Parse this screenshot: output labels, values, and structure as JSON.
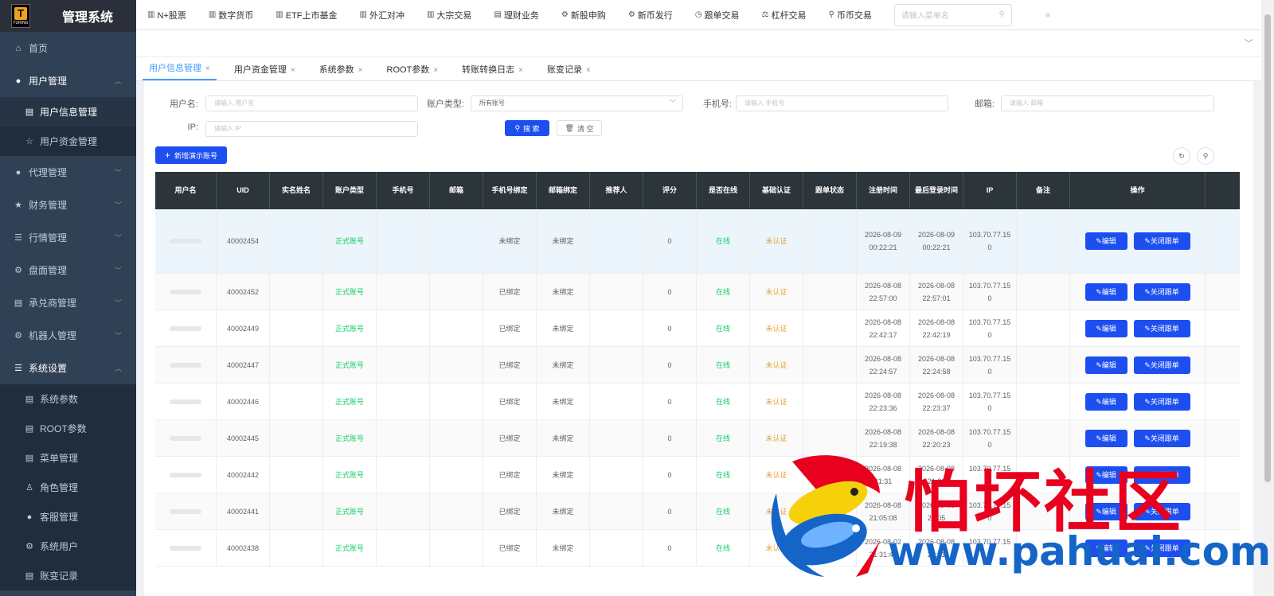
{
  "app": {
    "logo_text": "T",
    "logo_sub": "TURING",
    "title": "管理系统"
  },
  "sidebar": {
    "items": [
      {
        "label": "首页",
        "icon": "home-icon",
        "glyph": "⌂"
      },
      {
        "label": "用户管理",
        "icon": "user-icon",
        "glyph": "●",
        "expanded": true,
        "children": [
          {
            "label": "用户信息管理",
            "icon": "id-card-icon",
            "glyph": "▤",
            "active": true
          },
          {
            "label": "用户资金管理",
            "icon": "star-icon",
            "glyph": "☆"
          }
        ]
      },
      {
        "label": "代理管理",
        "icon": "user-icon",
        "glyph": "●"
      },
      {
        "label": "财务管理",
        "icon": "star-icon",
        "glyph": "★"
      },
      {
        "label": "行情管理",
        "icon": "list-icon",
        "glyph": "☰"
      },
      {
        "label": "盘面管理",
        "icon": "gear-icon",
        "glyph": "⚙"
      },
      {
        "label": "承兑商管理",
        "icon": "document-icon",
        "glyph": "▤"
      },
      {
        "label": "机器人管理",
        "icon": "gear-icon",
        "glyph": "⚙"
      },
      {
        "label": "系统设置",
        "icon": "list-icon",
        "glyph": "☰",
        "expanded": true,
        "children": [
          {
            "label": "系统参数",
            "icon": "document-icon",
            "glyph": "▤"
          },
          {
            "label": "ROOT参数",
            "icon": "document-icon",
            "glyph": "▤"
          },
          {
            "label": "菜单管理",
            "icon": "document-icon",
            "glyph": "▤"
          },
          {
            "label": "角色管理",
            "icon": "role-icon",
            "glyph": "♙"
          },
          {
            "label": "客服管理",
            "icon": "user-icon",
            "glyph": "●"
          },
          {
            "label": "系统用户",
            "icon": "gear-icon",
            "glyph": "⚙"
          },
          {
            "label": "账变记录",
            "icon": "document-icon",
            "glyph": "▤"
          }
        ]
      }
    ]
  },
  "topnav": {
    "items": [
      {
        "label": "N+股票",
        "icon": "chart-icon",
        "glyph": "▥"
      },
      {
        "label": "数字货币",
        "icon": "chart-icon",
        "glyph": "▥"
      },
      {
        "label": "ETF上市基金",
        "icon": "chart-icon",
        "glyph": "▥"
      },
      {
        "label": "外汇对冲",
        "icon": "chart-icon",
        "glyph": "▥"
      },
      {
        "label": "大宗交易",
        "icon": "chart-icon",
        "glyph": "▥"
      },
      {
        "label": "理财业务",
        "icon": "document-icon",
        "glyph": "▤"
      },
      {
        "label": "新股申购",
        "icon": "gear-icon",
        "glyph": "⚙"
      },
      {
        "label": "新币发行",
        "icon": "gear-icon",
        "glyph": "⚙"
      },
      {
        "label": "跟单交易",
        "icon": "clock-icon",
        "glyph": "◷"
      },
      {
        "label": "杠杆交易",
        "icon": "lever-icon",
        "glyph": "⚖"
      },
      {
        "label": "币币交易",
        "icon": "pin-icon",
        "glyph": "⚲"
      }
    ],
    "search_placeholder": "请输入菜单名"
  },
  "tabs": [
    {
      "label": "用户信息管理",
      "active": true
    },
    {
      "label": "用户资金管理"
    },
    {
      "label": "系统参数"
    },
    {
      "label": "ROOT参数"
    },
    {
      "label": "转账转换日志"
    },
    {
      "label": "账变记录"
    }
  ],
  "filters": {
    "username_label": "用户名:",
    "username_placeholder": "请输入 用户名",
    "type_label": "账户类型:",
    "type_value": "所有账号",
    "phone_label": "手机号:",
    "phone_placeholder": "请输入 手机号",
    "email_label": "邮箱:",
    "email_placeholder": "请输入 邮箱",
    "ip_label": "IP:",
    "ip_placeholder": "请输入 IP",
    "search_button": "搜 索",
    "clear_button": "清 空",
    "add_button": "新增演示账号"
  },
  "table": {
    "columns": [
      "用户名",
      "UID",
      "实名姓名",
      "账户类型",
      "手机号",
      "邮箱",
      "手机号绑定",
      "邮箱绑定",
      "推荐人",
      "评分",
      "是否在线",
      "基础认证",
      "跟单状态",
      "注册时间",
      "最后登录时间",
      "IP",
      "备注",
      "操作"
    ],
    "edit_label": "编辑",
    "close_label": "关闭跟单",
    "rows": [
      {
        "uid": "40002454",
        "type": "正式账号",
        "phone_bind": "未绑定",
        "email_bind": "未绑定",
        "score": "0",
        "online": "在线",
        "auth": "未认证",
        "reg_date": "2026-08-09",
        "reg_time": "00:22:21",
        "login_date": "2026-08-09",
        "login_time": "00:22:21",
        "ip1": "103.70.77.15",
        "ip2": "0"
      },
      {
        "uid": "40002452",
        "type": "正式账号",
        "phone_bind": "已绑定",
        "email_bind": "未绑定",
        "score": "0",
        "online": "在线",
        "auth": "未认证",
        "reg_date": "2026-08-08",
        "reg_time": "22:57:00",
        "login_date": "2026-08-08",
        "login_time": "22:57:01",
        "ip1": "103.70.77.15",
        "ip2": "0"
      },
      {
        "uid": "40002449",
        "type": "正式账号",
        "phone_bind": "已绑定",
        "email_bind": "未绑定",
        "score": "0",
        "online": "在线",
        "auth": "未认证",
        "reg_date": "2026-08-08",
        "reg_time": "22:42:17",
        "login_date": "2026-08-08",
        "login_time": "22:42:19",
        "ip1": "103.70.77.15",
        "ip2": "0"
      },
      {
        "uid": "40002447",
        "type": "正式账号",
        "phone_bind": "已绑定",
        "email_bind": "未绑定",
        "score": "0",
        "online": "在线",
        "auth": "未认证",
        "reg_date": "2026-08-08",
        "reg_time": "22:24:57",
        "login_date": "2026-08-08",
        "login_time": "22:24:58",
        "ip1": "103.70.77.15",
        "ip2": "0"
      },
      {
        "uid": "40002446",
        "type": "正式账号",
        "phone_bind": "已绑定",
        "email_bind": "未绑定",
        "score": "0",
        "online": "在线",
        "auth": "未认证",
        "reg_date": "2026-08-08",
        "reg_time": "22:23:36",
        "login_date": "2026-08-08",
        "login_time": "22:23:37",
        "ip1": "103.70.77.15",
        "ip2": "0"
      },
      {
        "uid": "40002445",
        "type": "正式账号",
        "phone_bind": "已绑定",
        "email_bind": "未绑定",
        "score": "0",
        "online": "在线",
        "auth": "未认证",
        "reg_date": "2026-08-08",
        "reg_time": "22:19:38",
        "login_date": "2026-08-08",
        "login_time": "22:20:23",
        "ip1": "103.70.77.15",
        "ip2": "0"
      },
      {
        "uid": "40002442",
        "type": "正式账号",
        "phone_bind": "已绑定",
        "email_bind": "未绑定",
        "score": "0",
        "online": "在线",
        "auth": "未认证",
        "reg_date": "2026-08-08",
        "reg_time": "21:31",
        "login_date": "2026-08-08",
        "login_time": "21:31",
        "ip1": "103.70.77.15",
        "ip2": "0"
      },
      {
        "uid": "40002441",
        "type": "正式账号",
        "phone_bind": "已绑定",
        "email_bind": "未绑定",
        "score": "0",
        "online": "在线",
        "auth": "未认证",
        "reg_date": "2026-08-08",
        "reg_time": "21:05:08",
        "login_date": "2026-08-08",
        "login_time": "21:05",
        "ip1": "103.70.77.15",
        "ip2": "0"
      },
      {
        "uid": "40002438",
        "type": "正式账号",
        "phone_bind": "已绑定",
        "email_bind": "未绑定",
        "score": "0",
        "online": "在线",
        "auth": "未认证",
        "reg_date": "2026-08-02",
        "reg_time": "21:31:45",
        "login_date": "2026-08-08",
        "login_time": "21:31",
        "ip1": "103.70.77.15",
        "ip2": "0"
      }
    ]
  },
  "watermark": {
    "cn": "怕坏社区",
    "url": "www.pahuai.com"
  },
  "colors": {
    "sidebar": "#304156",
    "header": "#2c3539",
    "primary": "#1d4ff0",
    "green": "#13ce66",
    "orange": "#e6a23c",
    "active_tab": "#409eff"
  }
}
